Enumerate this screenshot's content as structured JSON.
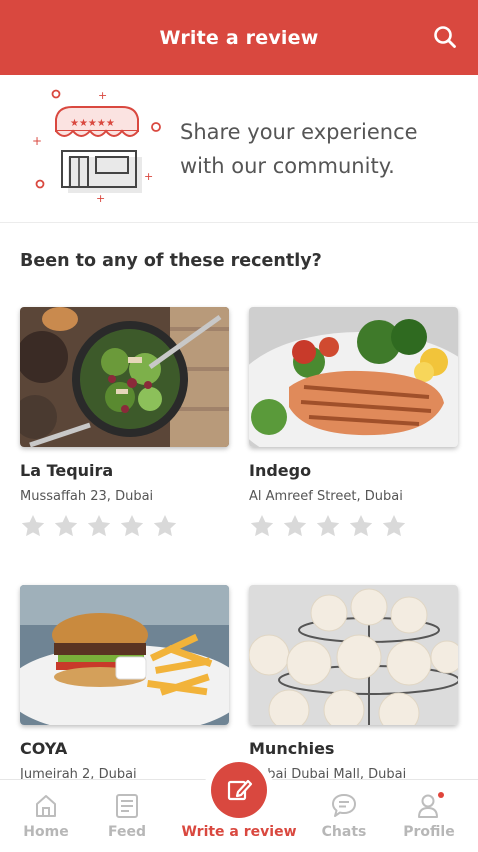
{
  "header": {
    "title": "Write a review",
    "search_icon": "search-icon",
    "background": "#d9483f"
  },
  "hero": {
    "illustration_icon": "storefront-stars-icon",
    "tagline_line1": "Share your experience",
    "tagline_line2": "with our community."
  },
  "recent": {
    "title": "Been to any of these recently?",
    "restaurants": [
      {
        "name": "La Tequira",
        "address": "Mussaffah 23, Dubai",
        "photo": "salad-bowl-photo",
        "rating": 0
      },
      {
        "name": "Indego",
        "address": "Al Amreef Street, Dubai",
        "photo": "grilled-salmon-photo",
        "rating": 0
      },
      {
        "name": "COYA",
        "address": "Jumeirah 2, Dubai",
        "photo": "burger-fries-photo",
        "rating": 0
      },
      {
        "name": "Munchies",
        "address": "Dubai Dubai Mall, Dubai",
        "photo": "cupcakes-photo",
        "rating": 0
      }
    ],
    "max_stars": 5
  },
  "bottom_nav": {
    "items": [
      {
        "label": "Home",
        "icon": "home-icon",
        "active": false
      },
      {
        "label": "Feed",
        "icon": "feed-icon",
        "active": false
      },
      {
        "label": "Write a review",
        "icon": "edit-icon",
        "active": true
      },
      {
        "label": "Chats",
        "icon": "chat-icon",
        "active": false
      },
      {
        "label": "Profile",
        "icon": "profile-icon",
        "active": false,
        "has_notification": true
      }
    ]
  },
  "colors": {
    "accent": "#d9483f",
    "inactive_nav": "#b7b7b7",
    "star_empty": "#d9d9d9"
  }
}
